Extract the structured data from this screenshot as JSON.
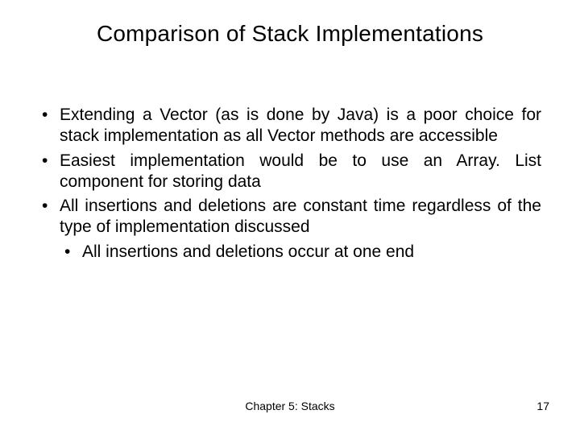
{
  "title": "Comparison of Stack Implementations",
  "bullets": [
    {
      "text": "Extending a Vector (as is done by Java) is a poor choice for stack implementation as all Vector methods are accessible"
    },
    {
      "text": "Easiest implementation would be to use an Array. List component for storing data"
    },
    {
      "text": "All insertions and deletions are constant time regardless of the type of implementation discussed",
      "sub": [
        "All insertions and deletions occur at one end"
      ]
    }
  ],
  "footer": {
    "chapter": "Chapter 5: Stacks",
    "page": "17"
  }
}
